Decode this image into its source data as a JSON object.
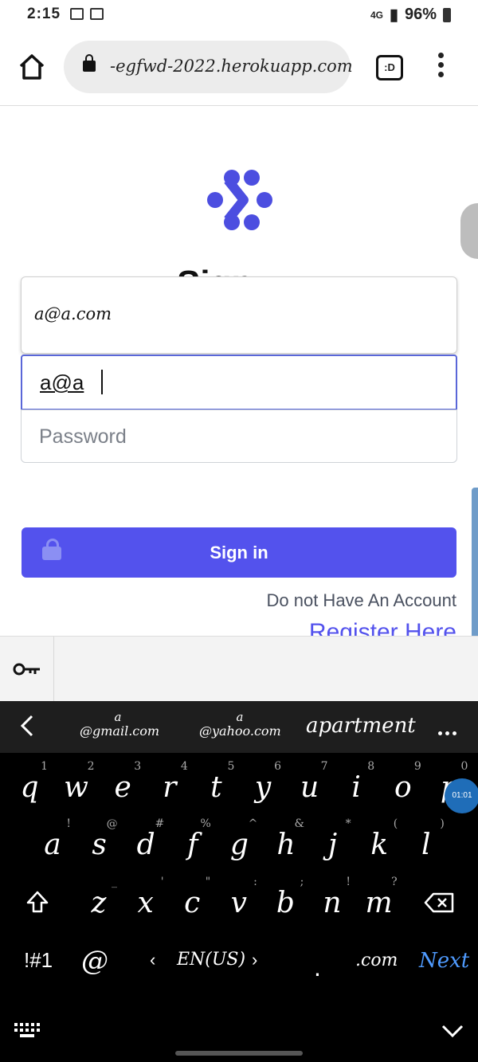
{
  "status_bar": {
    "time": "2:15",
    "network": "4G",
    "battery": "96%"
  },
  "browser": {
    "url": "-egfwd-2022.herokuapp.com",
    "tabs_label": ":D"
  },
  "page": {
    "title_fragment": "Sign In",
    "autofill_suggestion": "a@a.com",
    "email_value": "a@a",
    "password_placeholder": "Password",
    "signin_label": "Sign in",
    "no_account_text": "Do not Have An Account",
    "register_link": "Register Here"
  },
  "keyboard": {
    "suggestions": [
      {
        "top": "a",
        "main": "@gmail.com"
      },
      {
        "top": "a",
        "main": "@yahoo.com"
      },
      {
        "main": "apartment"
      }
    ],
    "row1": [
      {
        "k": "q",
        "s": "1"
      },
      {
        "k": "w",
        "s": "2"
      },
      {
        "k": "e",
        "s": "3"
      },
      {
        "k": "r",
        "s": "4"
      },
      {
        "k": "t",
        "s": "5"
      },
      {
        "k": "y",
        "s": "6"
      },
      {
        "k": "u",
        "s": "7"
      },
      {
        "k": "i",
        "s": "8"
      },
      {
        "k": "o",
        "s": "9"
      },
      {
        "k": "p",
        "s": "0"
      }
    ],
    "row2": [
      {
        "k": "a",
        "s": "!"
      },
      {
        "k": "s",
        "s": "@"
      },
      {
        "k": "d",
        "s": "#"
      },
      {
        "k": "f",
        "s": "%"
      },
      {
        "k": "g",
        "s": "^"
      },
      {
        "k": "h",
        "s": "&"
      },
      {
        "k": "j",
        "s": "*"
      },
      {
        "k": "k",
        "s": "("
      },
      {
        "k": "l",
        "s": ")"
      }
    ],
    "row3": [
      {
        "k": "z",
        "s": "_"
      },
      {
        "k": "x",
        "s": "'"
      },
      {
        "k": "c",
        "s": "\""
      },
      {
        "k": "v",
        "s": ":"
      },
      {
        "k": "b",
        "s": ";"
      },
      {
        "k": "n",
        "s": "!"
      },
      {
        "k": "m",
        "s": "?"
      }
    ],
    "symbols_key": "!#1",
    "at_key": "@",
    "language": "EN(US)",
    "dotcom_key": ".com",
    "next_key": "Next",
    "period_key": ".",
    "bubble_time": "01:01"
  }
}
